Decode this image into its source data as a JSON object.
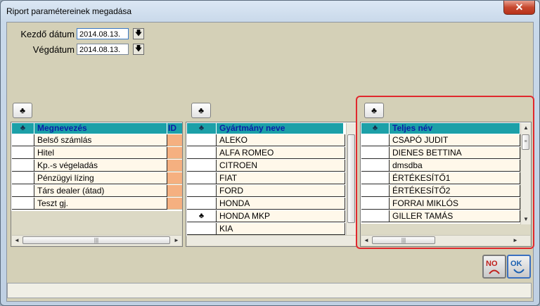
{
  "window": {
    "title": "Riport paramétereinek megadása",
    "close_label": "✕"
  },
  "dates": {
    "start_label": "Kezdő dátum",
    "start_value": "2014.08.13.",
    "end_label": "Végdátum",
    "end_value": "2014.08.13."
  },
  "icons": {
    "club": "♣",
    "down_arrow": "🡇",
    "scroll_left": "◄",
    "scroll_right": "►",
    "scroll_up": "▲",
    "scroll_down": "▼",
    "grip_h": "|||",
    "grip_v": "≡"
  },
  "grid1": {
    "sel_header": "♣",
    "col_name": "Megnevezés",
    "col_id": "ID",
    "rows": [
      "Belső számlás",
      "Hitel",
      "Kp.-s végeladás",
      "Pénzügyi lízing",
      "Társ dealer (átad)",
      "Teszt gj."
    ]
  },
  "grid2": {
    "sel_header": "♣",
    "col_name": "Gyártmány neve",
    "rows": [
      "ALEKO",
      "ALFA ROMEO",
      "CITROEN",
      "FIAT",
      "FORD",
      "HONDA",
      "HONDA MKP",
      "KIA"
    ],
    "marked_row": "HONDA MKP"
  },
  "grid3": {
    "sel_header": "♣",
    "col_name": "Teljes név",
    "rows": [
      "CSAPÓ JUDIT",
      "DIENES BETTINA",
      "dmsdba",
      "ÉRTÉKESÍTŐ1",
      "ÉRTÉKESÍTŐ2",
      "FORRAI MIKLÓS",
      "GILLER TAMÁS"
    ]
  },
  "buttons": {
    "no_label": "NO",
    "ok_label": "OK"
  },
  "colors": {
    "header": "#1ca0a8",
    "highlight": "#e0282d",
    "id_cell": "#f5b080"
  }
}
